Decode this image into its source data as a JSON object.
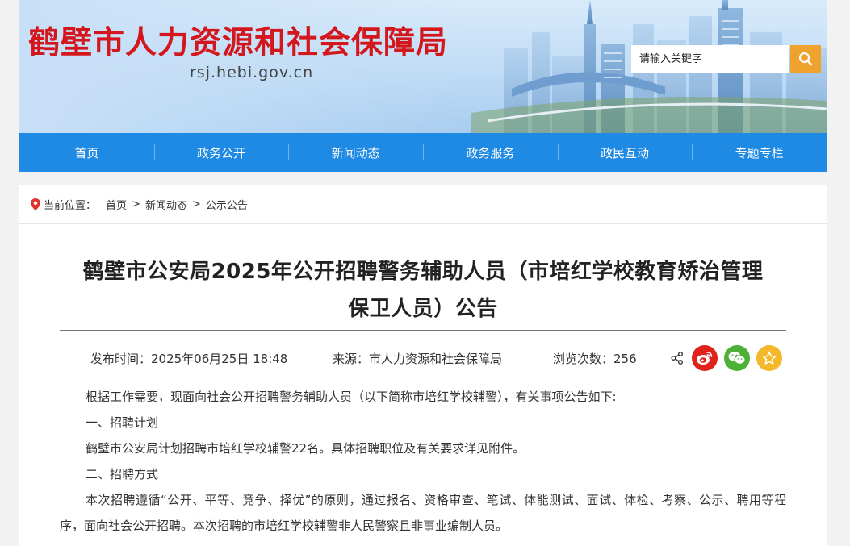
{
  "header": {
    "site_title": "鹤壁市人力资源和社会保障局",
    "site_domain": "rsj.hebi.gov.cn",
    "search_placeholder": "请输入关键字",
    "accent_color": "#d3171d",
    "search_button_color": "#f0a22f",
    "search_icon": "search-icon"
  },
  "nav": {
    "color": "#1f8ae3",
    "items": [
      "首页",
      "政务公开",
      "新闻动态",
      "政务服务",
      "政民互动",
      "专题专栏"
    ]
  },
  "breadcrumb": {
    "icon": "location-pin-icon",
    "label": "当前位置：",
    "items": [
      "首页",
      "新闻动态",
      "公示公告"
    ],
    "separator": ">"
  },
  "article": {
    "title_line1": "鹤壁市公安局2025年公开招聘警务辅助人员（市培红学校教育矫治管理",
    "title_line2": "保卫人员）公告",
    "publish_time": "发布时间：2025年06月25日 18:48",
    "source": "来源：市人力资源和社会保障局",
    "views": "浏览次数：256",
    "share_buttons": [
      {
        "icon": "weibo-icon",
        "color": "#e0221c"
      },
      {
        "icon": "wechat-icon",
        "color": "#4cb134"
      },
      {
        "icon": "star-icon",
        "color": "#f5b82a"
      }
    ],
    "paragraphs": [
      "根据工作需要，现面向社会公开招聘警务辅助人员（以下简称市培红学校辅警），有关事项公告如下:",
      "一、招聘计划",
      "鹤壁市公安局计划招聘市培红学校辅警22名。具体招聘职位及有关要求详见附件。",
      "二、招聘方式",
      "本次招聘遵循“公开、平等、竞争、择优”的原则，通过报名、资格审查、笔试、体能测试、面试、体检、考察、公示、聘用等程序，面向社会公开招聘。本次招聘的市培红学校辅警非人民警察且非事业编制人员。"
    ]
  }
}
